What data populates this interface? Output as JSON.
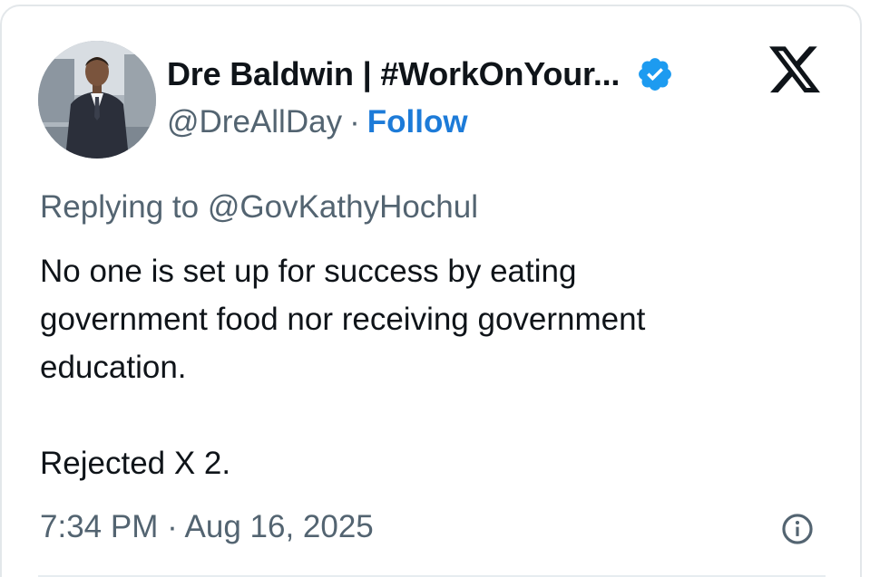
{
  "author": {
    "display_name": "Dre Baldwin | #WorkOnYour...",
    "handle": "@DreAllDay",
    "separator": "·",
    "follow_label": "Follow",
    "verified_icon": "verified-badge-icon",
    "avatar_icon": "avatar-photo"
  },
  "platform": {
    "logo_icon": "x-logo-icon"
  },
  "tweet": {
    "reply_prefix": "Replying to",
    "reply_to": "@GovKathyHochul",
    "text": "No one is set up for success by eating\ngovernment food nor receiving government\neducation.\n\nRejected X 2.",
    "timestamp": "7:34 PM · Aug 16, 2025",
    "info_icon": "info-icon"
  },
  "colors": {
    "text_primary": "#0f1419",
    "text_secondary": "#536471",
    "link_blue": "#1d7bd8",
    "verified_blue": "#1d9bf0",
    "border": "#e3e7ea"
  }
}
